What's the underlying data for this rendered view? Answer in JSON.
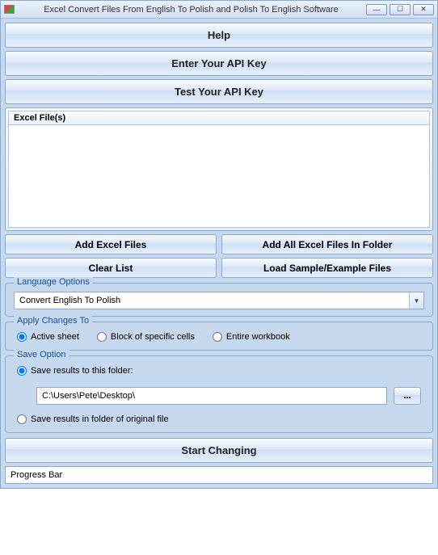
{
  "window": {
    "title": "Excel Convert Files From English To Polish and Polish To English Software"
  },
  "buttons": {
    "help": "Help",
    "enter_api": "Enter Your API Key",
    "test_api": "Test Your API Key",
    "add_files": "Add Excel Files",
    "add_folder": "Add All Excel Files In Folder",
    "clear_list": "Clear List",
    "load_sample": "Load Sample/Example Files",
    "start": "Start Changing",
    "browse": "..."
  },
  "file_list": {
    "header": "Excel File(s)"
  },
  "groups": {
    "language": {
      "title": "Language Options",
      "selected": "Convert English To Polish"
    },
    "apply": {
      "title": "Apply Changes To",
      "options": {
        "active": "Active sheet",
        "block": "Block of specific cells",
        "entire": "Entire workbook"
      },
      "selected": "active"
    },
    "save": {
      "title": "Save Option",
      "options": {
        "to_folder": "Save results to this folder:",
        "original": "Save results in folder of original file"
      },
      "selected": "to_folder",
      "path": "C:\\Users\\Pete\\Desktop\\"
    }
  },
  "progress": {
    "label": "Progress Bar"
  }
}
